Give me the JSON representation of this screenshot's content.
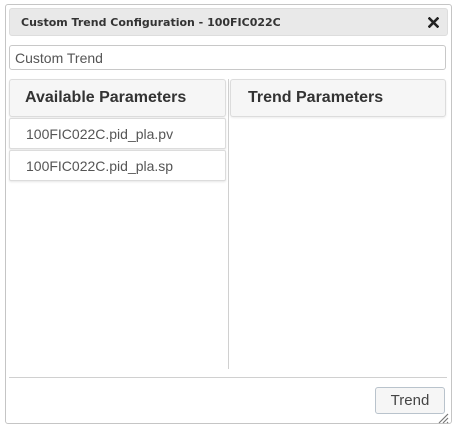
{
  "dialog": {
    "title": "Custom Trend Configuration - 100FIC022C",
    "close_icon": "close-icon"
  },
  "name_input": {
    "value": "Custom Trend"
  },
  "available": {
    "header": "Available Parameters",
    "items": [
      {
        "label": "100FIC022C.pid_pla.pv"
      },
      {
        "label": "100FIC022C.pid_pla.sp"
      }
    ]
  },
  "trend": {
    "header": "Trend Parameters",
    "items": []
  },
  "footer": {
    "trend_button": "Trend",
    "resize_icon": "resize-grip-icon"
  }
}
